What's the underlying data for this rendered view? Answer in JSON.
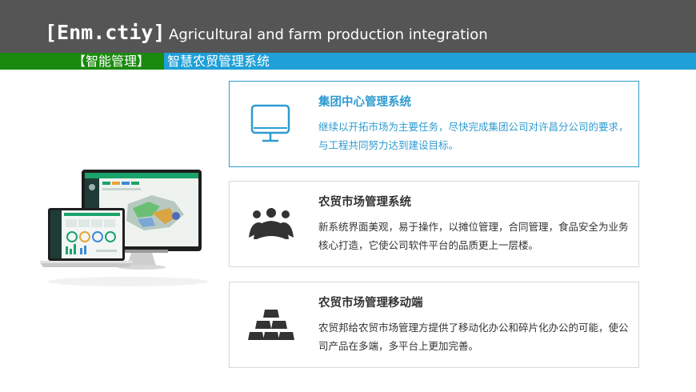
{
  "header": {
    "brand": "[Enm.ctiy]",
    "subtitle": "Agricultural and farm production integration"
  },
  "band": {
    "tag": "【智能管理】",
    "title": "智慧农贸管理系统"
  },
  "colors": {
    "header_bg": "#555555",
    "green": "#1a8a0f",
    "blue": "#1fa0d8",
    "accent": "#2e9bd0"
  },
  "cards": [
    {
      "title": "集团中心管理系统",
      "desc": "继续以开拓市场为主要任务，尽快完成集团公司对许昌分公司的要求，与工程共同努力达到建设目标。",
      "icon": "monitor-icon"
    },
    {
      "title": "农贸市场管理系统",
      "desc": "新系统界面美观，易于操作，以摊位管理，合同管理，食品安全为业务核心打造，它使公司软件平台的品质更上一层楼。",
      "icon": "users-group-icon"
    },
    {
      "title": "农贸市场管理移动端",
      "desc": "农贸邦给农贸市场管理方提供了移动化办公和碎片化办公的可能，使公司产品在多端，多平台上更加完善。",
      "icon": "stacked-bars-icon"
    }
  ]
}
